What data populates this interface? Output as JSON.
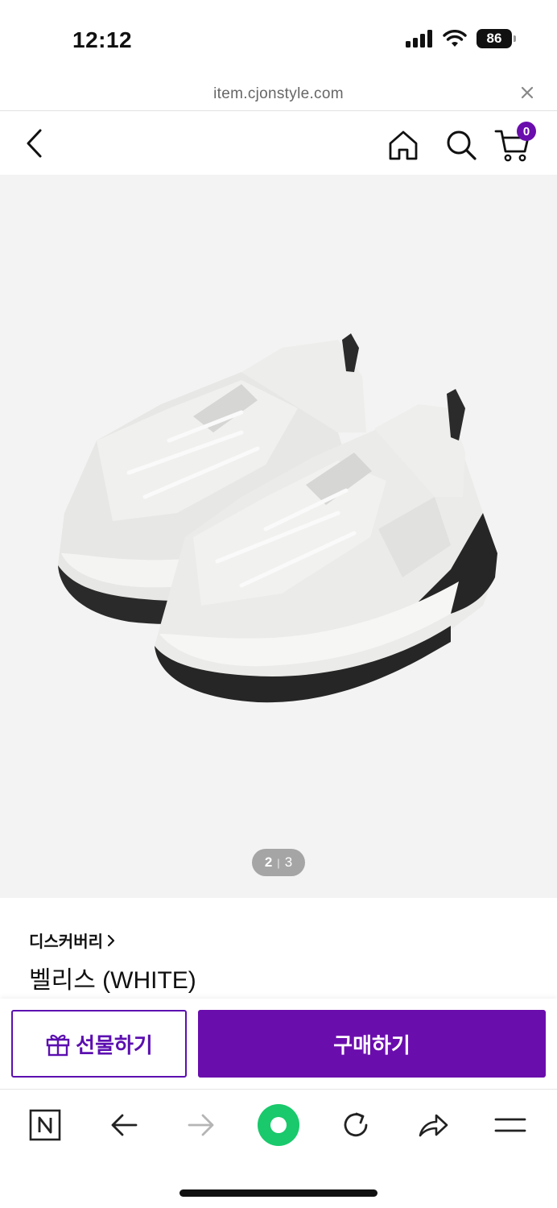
{
  "status_bar": {
    "time": "12:12",
    "battery": "86",
    "icons": [
      "cellular-signal-icon",
      "wifi-icon",
      "battery-icon"
    ]
  },
  "url_bar": {
    "url": "item.cjonstyle.com"
  },
  "header": {
    "cart_count": "0"
  },
  "product": {
    "image_counter": {
      "current": "2",
      "separator": "|",
      "total": "3"
    },
    "brand": "디스커버리",
    "name": "벨리스 (WHITE)"
  },
  "actions": {
    "gift_label": "선물하기",
    "buy_label": "구매하기"
  },
  "colors": {
    "brand_purple": "#6a0dad",
    "naver_green": "#19c96b",
    "image_bg": "#f3f3f3"
  },
  "browser_toolbar": {
    "icons": [
      "naver-n-icon",
      "back-arrow-icon",
      "forward-arrow-icon",
      "green-dot-icon",
      "refresh-icon",
      "share-icon",
      "menu-icon"
    ]
  }
}
